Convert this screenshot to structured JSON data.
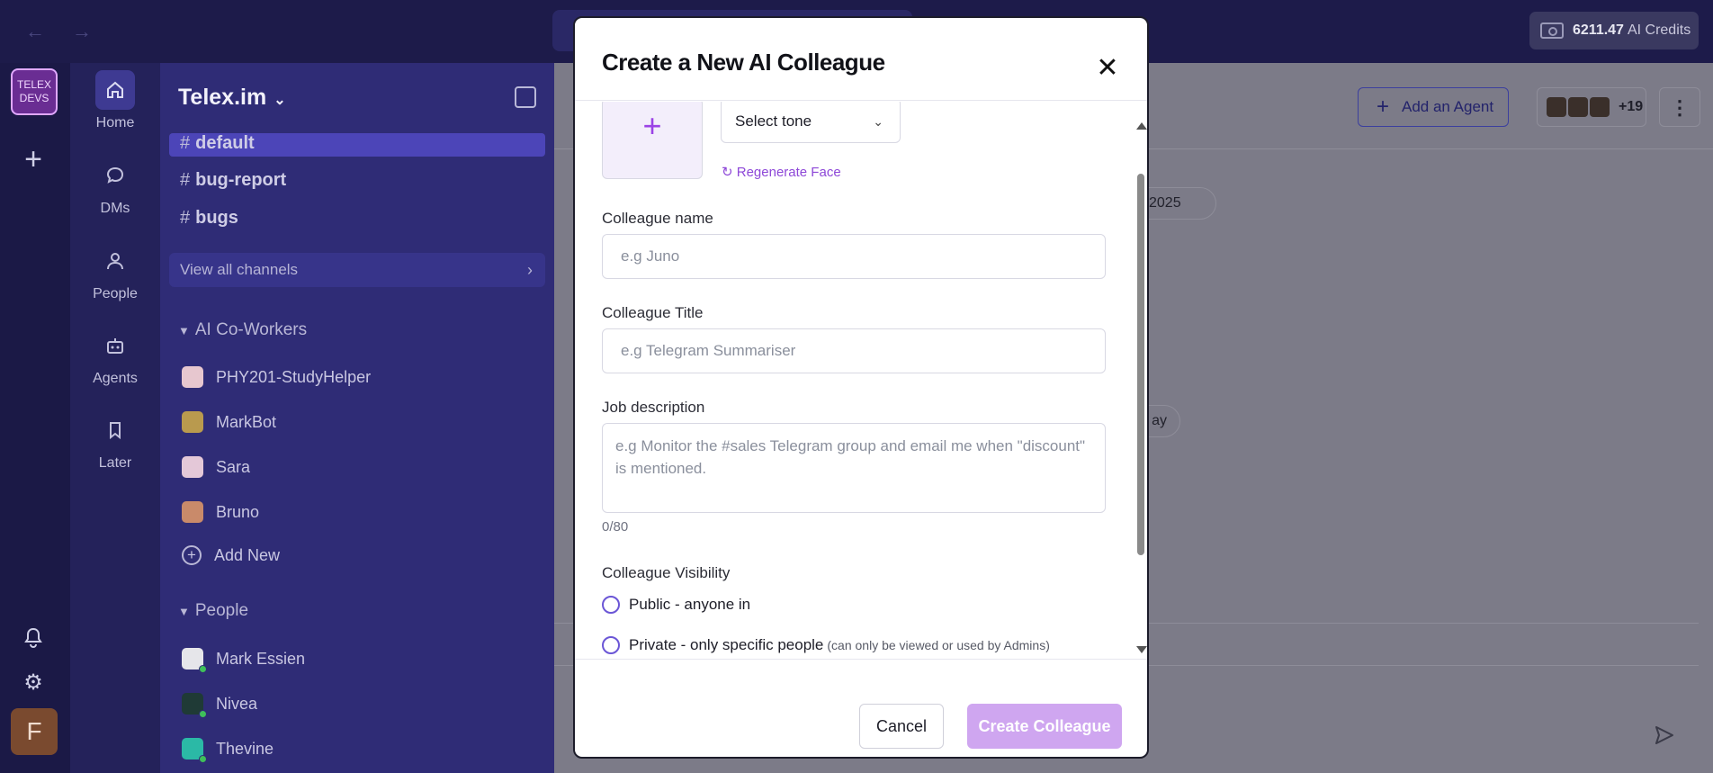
{
  "topbar": {
    "back_icon": "arrow-left-icon",
    "forward_icon": "arrow-right-icon",
    "credits_amount": "6211.47",
    "credits_unit": "AI Credits"
  },
  "rail": {
    "workspace_badge_line1": "TELEX",
    "workspace_badge_line2": "DEVS",
    "avatar_letter": "F"
  },
  "nav": {
    "items": [
      {
        "label": "Home",
        "icon": "home-icon"
      },
      {
        "label": "DMs",
        "icon": "chat-icon"
      },
      {
        "label": "People",
        "icon": "person-icon"
      },
      {
        "label": "Agents",
        "icon": "bot-icon"
      },
      {
        "label": "Later",
        "icon": "bookmark-icon"
      }
    ]
  },
  "sidebar": {
    "workspace_name": "Telex.im",
    "channels": [
      "default",
      "bug-report",
      "bugs"
    ],
    "view_all": "View all channels",
    "ai_section": "AI Co-Workers",
    "ai_workers": [
      "PHY201-StudyHelper",
      "MarkBot",
      "Sara",
      "Bruno"
    ],
    "add_new": "Add New",
    "people_section": "People",
    "people": [
      "Mark Essien",
      "Nivea",
      "Thevine"
    ]
  },
  "main": {
    "add_agent": "Add an Agent",
    "member_count": "+19",
    "date_pill_1": "2025",
    "date_pill_2": "ay"
  },
  "modal": {
    "title": "Create a New AI Colleague",
    "tone_placeholder": "Select tone",
    "regenerate": "Regenerate Face",
    "name_label": "Colleague name",
    "name_placeholder": "e.g Juno",
    "title_label": "Colleague Title",
    "title_placeholder": "e.g Telegram Summariser",
    "job_label": "Job description",
    "job_placeholder": "e.g Monitor the #sales Telegram group and email me when \"discount\" is mentioned.",
    "job_counter": "0/80",
    "visibility_label": "Colleague Visibility",
    "public_option": "Public - anyone in",
    "private_option": "Private - only specific people",
    "private_note": "(can only be viewed or used by Admins)",
    "cancel": "Cancel",
    "create": "Create Colleague"
  }
}
